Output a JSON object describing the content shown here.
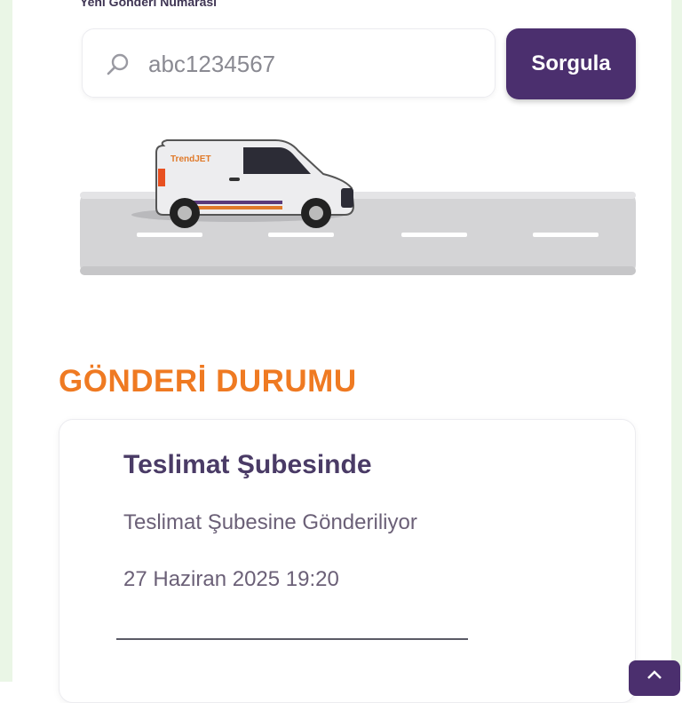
{
  "tracking": {
    "label": "Yeni Gönderi Numarası",
    "input_value": "abc1234567",
    "query_button": "Sorgula"
  },
  "illustration": {
    "van_brand": "TrendJET"
  },
  "status": {
    "section_title": "GÖNDERİ DURUMU",
    "title": "Teslimat Şubesinde",
    "description": "Teslimat Şubesine Gönderiliyor",
    "datetime": "27 Haziran 2025 19:20"
  },
  "colors": {
    "primary": "#4b2f6e",
    "accent_orange": "#ef7a22",
    "status_text": "#4a3b66"
  },
  "icons": {
    "search": "search-icon",
    "corner": "chevron-up-icon"
  }
}
